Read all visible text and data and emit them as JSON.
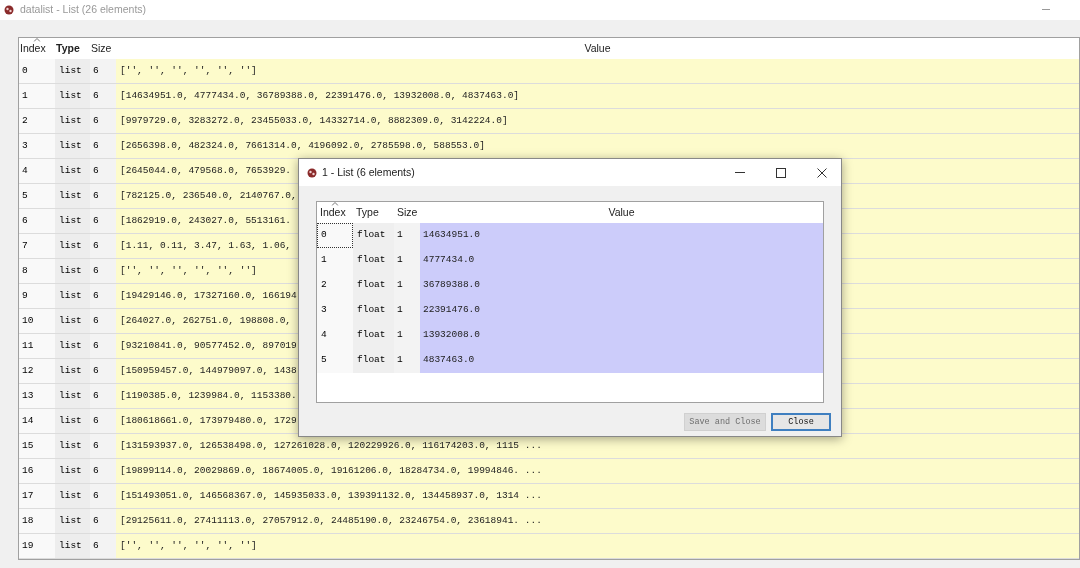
{
  "window": {
    "title": "datalist - List (26 elements)"
  },
  "table": {
    "columns": [
      {
        "label": "Index",
        "sorted": true,
        "bold": false
      },
      {
        "label": "Type",
        "sorted": false,
        "bold": true
      },
      {
        "label": "Size",
        "sorted": false,
        "bold": false
      },
      {
        "label": "Value",
        "sorted": false,
        "bold": false
      }
    ],
    "rows": [
      {
        "index": "0",
        "type": "list",
        "size": "6",
        "value": "['', '', '', '', '', '']"
      },
      {
        "index": "1",
        "type": "list",
        "size": "6",
        "value": "[14634951.0, 4777434.0, 36789388.0, 22391476.0, 13932008.0, 4837463.0]"
      },
      {
        "index": "2",
        "type": "list",
        "size": "6",
        "value": "[9979729.0, 3283272.0, 23455033.0, 14332714.0, 8882309.0, 3142224.0]"
      },
      {
        "index": "3",
        "type": "list",
        "size": "6",
        "value": "[2656398.0, 482324.0, 7661314.0, 4196092.0, 2785598.0, 588553.0]"
      },
      {
        "index": "4",
        "type": "list",
        "size": "6",
        "value": "[2645044.0, 479568.0, 7653929."
      },
      {
        "index": "5",
        "type": "list",
        "size": "6",
        "value": "[782125.0, 236540.0, 2140767.0,"
      },
      {
        "index": "6",
        "type": "list",
        "size": "6",
        "value": "[1862919.0, 243027.0, 5513161."
      },
      {
        "index": "7",
        "type": "list",
        "size": "6",
        "value": "[1.11, 0.11, 3.47, 1.63, 1.06,"
      },
      {
        "index": "8",
        "type": "list",
        "size": "6",
        "value": "['', '', '', '', '', '']"
      },
      {
        "index": "9",
        "type": "list",
        "size": "6",
        "value": "[19429146.0, 17327160.0, 166194"
      },
      {
        "index": "10",
        "type": "list",
        "size": "6",
        "value": "[264027.0, 262751.0, 198808.0,"
      },
      {
        "index": "11",
        "type": "list",
        "size": "6",
        "value": "[93210841.0, 90577452.0, 897019"
      },
      {
        "index": "12",
        "type": "list",
        "size": "6",
        "value": "[150959457.0, 144979097.0, 1438"
      },
      {
        "index": "13",
        "type": "list",
        "size": "6",
        "value": "[1190385.0, 1239984.0, 1153380."
      },
      {
        "index": "14",
        "type": "list",
        "size": "6",
        "value": "[180618661.0, 173979480.0, 1729"
      },
      {
        "index": "15",
        "type": "list",
        "size": "6",
        "value": "[131593937.0, 126538498.0, 127261028.0, 120229926.0, 116174203.0, 1115 ..."
      },
      {
        "index": "16",
        "type": "list",
        "size": "6",
        "value": "[19899114.0, 20029869.0, 18674005.0, 19161206.0, 18284734.0, 19994846. ..."
      },
      {
        "index": "17",
        "type": "list",
        "size": "6",
        "value": "[151493051.0, 146568367.0, 145935033.0, 139391132.0, 134458937.0, 1314 ..."
      },
      {
        "index": "18",
        "type": "list",
        "size": "6",
        "value": "[29125611.0, 27411113.0, 27057912.0, 24485190.0, 23246754.0, 23618941. ..."
      },
      {
        "index": "19",
        "type": "list",
        "size": "6",
        "value": "['', '', '', '', '', '']"
      }
    ]
  },
  "dialog": {
    "title": "1 - List (6 elements)",
    "columns": [
      {
        "label": "Index",
        "sorted": true
      },
      {
        "label": "Type",
        "sorted": false
      },
      {
        "label": "Size",
        "sorted": false
      },
      {
        "label": "Value",
        "sorted": false
      }
    ],
    "rows": [
      {
        "index": "0",
        "type": "float",
        "size": "1",
        "value": "14634951.0",
        "focused": true
      },
      {
        "index": "1",
        "type": "float",
        "size": "1",
        "value": "4777434.0",
        "focused": false
      },
      {
        "index": "2",
        "type": "float",
        "size": "1",
        "value": "36789388.0",
        "focused": false
      },
      {
        "index": "3",
        "type": "float",
        "size": "1",
        "value": "22391476.0",
        "focused": false
      },
      {
        "index": "4",
        "type": "float",
        "size": "1",
        "value": "13932008.0",
        "focused": false
      },
      {
        "index": "5",
        "type": "float",
        "size": "1",
        "value": "4837463.0",
        "focused": false
      }
    ],
    "buttons": [
      {
        "label": "Save and Close",
        "disabled": true
      },
      {
        "label": "Close",
        "disabled": false
      }
    ]
  }
}
